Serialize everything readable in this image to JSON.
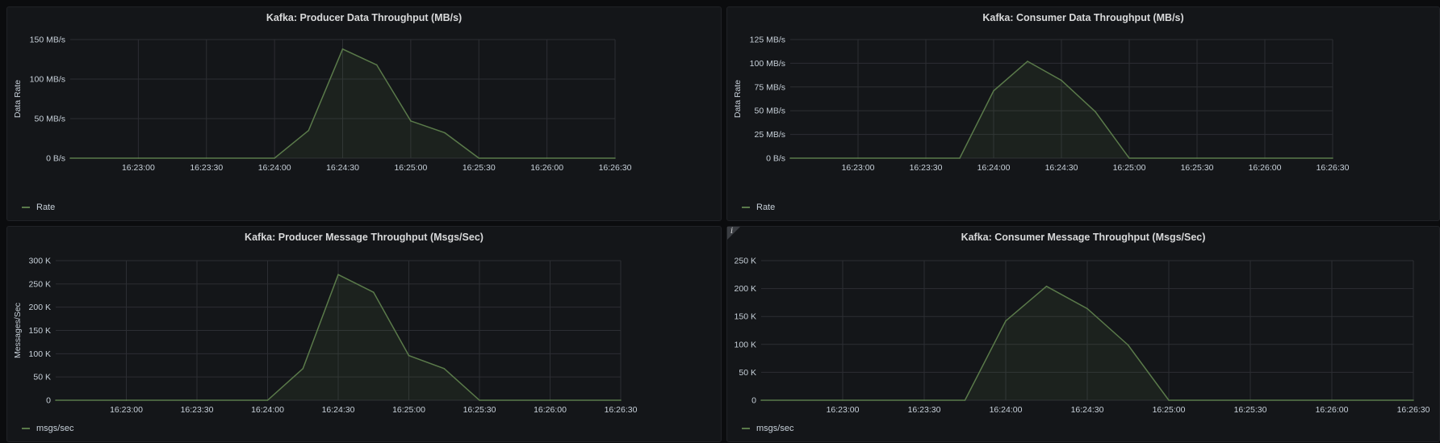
{
  "chart_data": [
    {
      "type": "area",
      "title": "Kafka: Producer Data Throughput (MB/s)",
      "ylabel": "Data Rate",
      "y_unit": "MB/s",
      "ylim": [
        0,
        150
      ],
      "y_ticks": [
        0,
        50,
        100,
        150
      ],
      "y_tick_labels": [
        "0 B/s",
        "50 MB/s",
        "100 MB/s",
        "150 MB/s"
      ],
      "xlim": [
        "16:22:30",
        "16:26:30"
      ],
      "x_ticks": [
        "16:23:00",
        "16:23:30",
        "16:24:00",
        "16:24:30",
        "16:25:00",
        "16:25:30",
        "16:26:00",
        "16:26:30"
      ],
      "legend_position": "bottom-left",
      "grid": true,
      "series": [
        {
          "name": "Rate",
          "color": "#5a7a4a",
          "x": [
            "16:22:30",
            "16:23:00",
            "16:23:30",
            "16:24:00",
            "16:24:15",
            "16:24:30",
            "16:24:45",
            "16:25:00",
            "16:25:15",
            "16:25:30",
            "16:26:00",
            "16:26:30"
          ],
          "values": [
            0,
            0,
            0,
            0,
            35,
            138,
            118,
            47,
            32,
            0,
            0,
            0
          ]
        }
      ]
    },
    {
      "type": "area",
      "title": "Kafka: Consumer Data Throughput (MB/s)",
      "ylabel": "Data Rate",
      "y_unit": "MB/s",
      "ylim": [
        0,
        125
      ],
      "y_ticks": [
        0,
        25,
        50,
        75,
        100,
        125
      ],
      "y_tick_labels": [
        "0 B/s",
        "25 MB/s",
        "50 MB/s",
        "75 MB/s",
        "100 MB/s",
        "125 MB/s"
      ],
      "xlim": [
        "16:22:30",
        "16:26:30"
      ],
      "x_ticks": [
        "16:23:00",
        "16:23:30",
        "16:24:00",
        "16:24:30",
        "16:25:00",
        "16:25:30",
        "16:26:00",
        "16:26:30"
      ],
      "legend_position": "bottom-left",
      "grid": true,
      "series": [
        {
          "name": "Rate",
          "color": "#5a7a4a",
          "x": [
            "16:22:30",
            "16:23:00",
            "16:23:30",
            "16:23:45",
            "16:24:00",
            "16:24:15",
            "16:24:30",
            "16:24:45",
            "16:25:00",
            "16:25:30",
            "16:26:00",
            "16:26:30"
          ],
          "values": [
            0,
            0,
            0,
            0,
            71,
            102,
            82,
            49,
            0,
            0,
            0,
            0
          ]
        }
      ]
    },
    {
      "type": "area",
      "title": "Kafka: Producer Message Throughput (Msgs/Sec)",
      "ylabel": "Messages/Sec",
      "y_unit": "K",
      "ylim": [
        0,
        300
      ],
      "y_ticks": [
        0,
        50,
        100,
        150,
        200,
        250,
        300
      ],
      "y_tick_labels": [
        "0",
        "50 K",
        "100 K",
        "150 K",
        "200 K",
        "250 K",
        "300 K"
      ],
      "xlim": [
        "16:22:30",
        "16:26:30"
      ],
      "x_ticks": [
        "16:23:00",
        "16:23:30",
        "16:24:00",
        "16:24:30",
        "16:25:00",
        "16:25:30",
        "16:26:00",
        "16:26:30"
      ],
      "legend_position": "bottom-left",
      "grid": true,
      "series": [
        {
          "name": "msgs/sec",
          "color": "#5a7a4a",
          "x": [
            "16:22:30",
            "16:23:00",
            "16:23:30",
            "16:24:00",
            "16:24:15",
            "16:24:30",
            "16:24:45",
            "16:25:00",
            "16:25:15",
            "16:25:30",
            "16:26:00",
            "16:26:30"
          ],
          "values": [
            0,
            0,
            0,
            0,
            68,
            270,
            232,
            96,
            68,
            0,
            0,
            0
          ]
        }
      ]
    },
    {
      "type": "area",
      "title": "Kafka: Consumer Message Throughput (Msgs/Sec)",
      "ylabel": "",
      "y_unit": "K",
      "ylim": [
        0,
        250
      ],
      "y_ticks": [
        0,
        50,
        100,
        150,
        200,
        250
      ],
      "y_tick_labels": [
        "0",
        "50 K",
        "100 K",
        "150 K",
        "200 K",
        "250 K"
      ],
      "xlim": [
        "16:22:30",
        "16:26:30"
      ],
      "x_ticks": [
        "16:23:00",
        "16:23:30",
        "16:24:00",
        "16:24:30",
        "16:25:00",
        "16:25:30",
        "16:26:00",
        "16:26:30"
      ],
      "legend_position": "bottom-left",
      "grid": true,
      "series": [
        {
          "name": "msgs/sec",
          "color": "#5a7a4a",
          "x": [
            "16:22:30",
            "16:23:00",
            "16:23:30",
            "16:23:45",
            "16:24:00",
            "16:24:15",
            "16:24:30",
            "16:24:45",
            "16:25:00",
            "16:25:30",
            "16:26:00",
            "16:26:30"
          ],
          "values": [
            0,
            0,
            0,
            0,
            142,
            204,
            164,
            99,
            0,
            0,
            0,
            0
          ]
        }
      ]
    }
  ],
  "info_icon": "info-icon",
  "theme": {
    "grid": "#2c2e33",
    "axis_text": "#c7d0d9",
    "fill": "#5a7a4a"
  }
}
